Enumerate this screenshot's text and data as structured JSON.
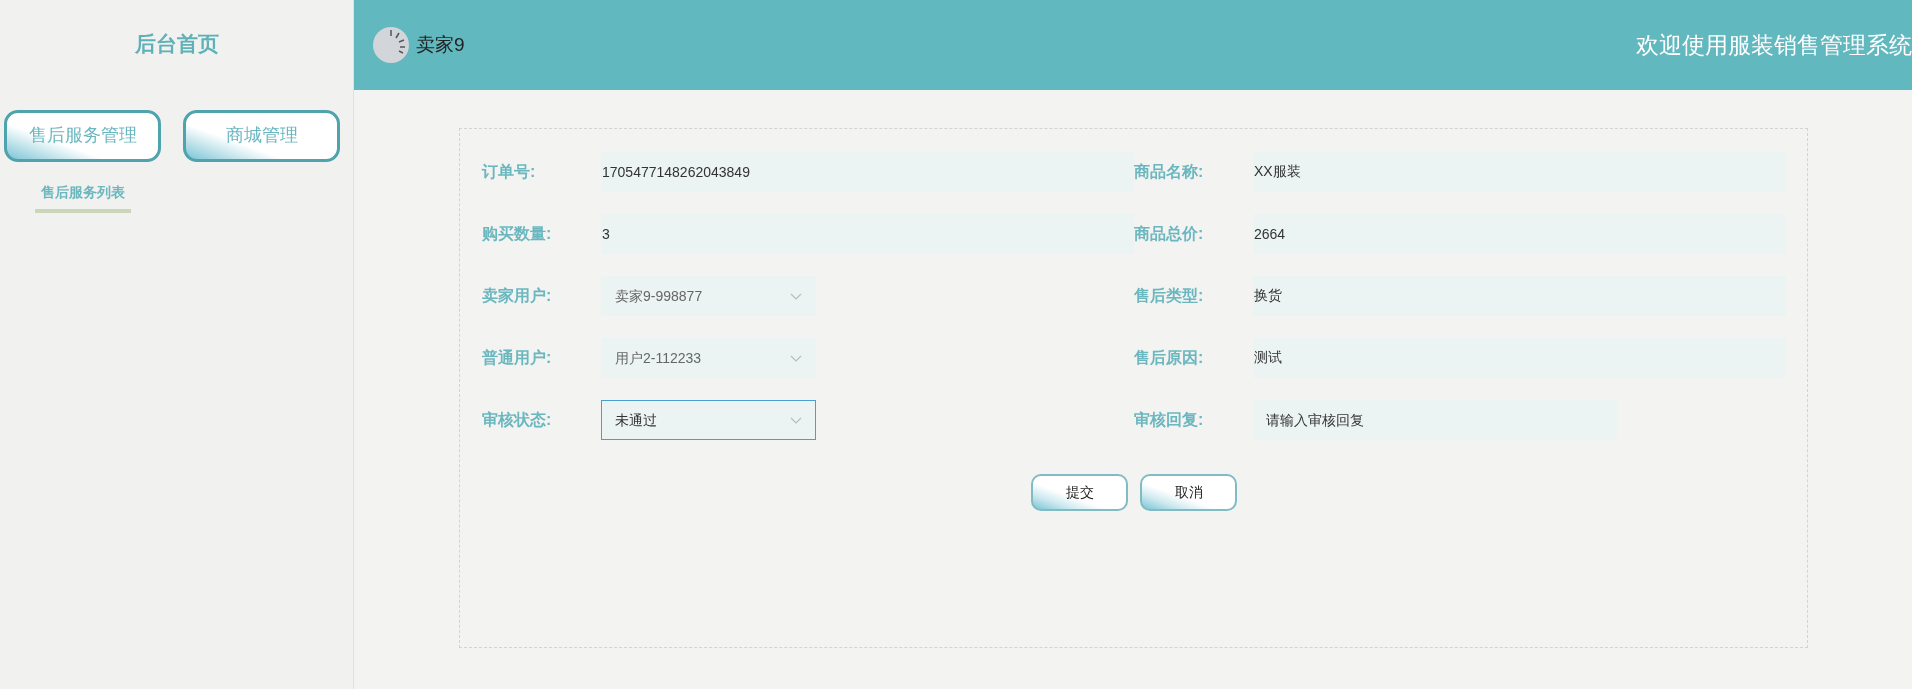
{
  "sidebar": {
    "title": "后台首页",
    "menus": [
      {
        "label": "售后服务管理",
        "children": [
          {
            "label": "售后服务列表"
          }
        ]
      },
      {
        "label": "商城管理"
      }
    ]
  },
  "header": {
    "username": "卖家9",
    "welcome": "欢迎使用服装销售管理系统"
  },
  "form": {
    "fields": [
      {
        "kind": "text",
        "label": "订单号:",
        "value": "1705477148262043849",
        "disabled": false,
        "focused": false
      },
      {
        "kind": "text",
        "label": "商品名称:",
        "value": "XX服装",
        "disabled": false,
        "focused": false
      },
      {
        "kind": "text",
        "label": "购买数量:",
        "value": "3",
        "disabled": false,
        "focused": false
      },
      {
        "kind": "text",
        "label": "商品总价:",
        "value": "2664",
        "disabled": false,
        "focused": false
      },
      {
        "kind": "select",
        "label": "卖家用户:",
        "value": "卖家9-998877",
        "disabled": true,
        "focused": false
      },
      {
        "kind": "text",
        "label": "售后类型:",
        "value": "换货",
        "disabled": false,
        "focused": false
      },
      {
        "kind": "select",
        "label": "普通用户:",
        "value": "用户2-112233",
        "disabled": true,
        "focused": false
      },
      {
        "kind": "text",
        "label": "售后原因:",
        "value": "测试",
        "disabled": false,
        "focused": false
      },
      {
        "kind": "select",
        "label": "审核状态:",
        "value": "未通过",
        "disabled": false,
        "focused": true
      },
      {
        "kind": "textarea",
        "label": "审核回复:",
        "placeholder": "请输入审核回复",
        "disabled": false,
        "focused": false
      }
    ],
    "buttons": [
      {
        "label": "提交"
      },
      {
        "label": "取消"
      }
    ]
  }
}
